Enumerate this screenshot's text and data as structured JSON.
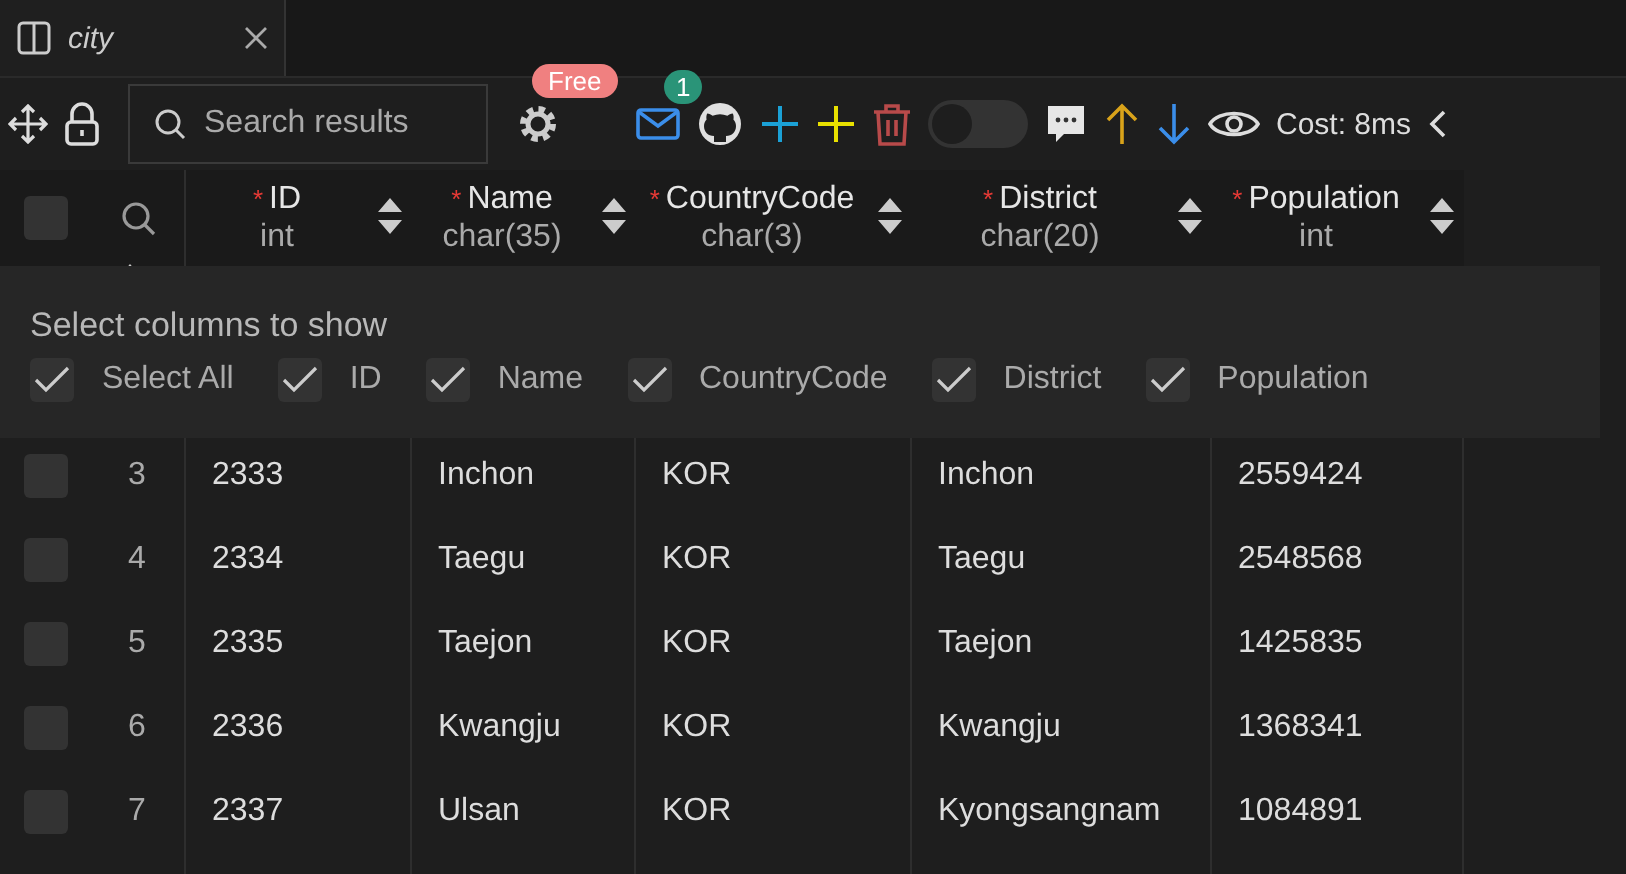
{
  "tab": {
    "title": "city"
  },
  "toolbar": {
    "search": {
      "placeholder": "Search results"
    },
    "free_badge": "Free",
    "mail_badge": "1",
    "toggle": {
      "on": false
    },
    "cost": "Cost: 8ms"
  },
  "table": {
    "header_checkbox": {
      "checked": false
    },
    "columns": [
      {
        "marker": "*",
        "name": "ID",
        "type": "int"
      },
      {
        "marker": "*",
        "name": "Name",
        "type": "char(35)"
      },
      {
        "marker": "*",
        "name": "CountryCode",
        "type": "char(3)"
      },
      {
        "marker": "*",
        "name": "District",
        "type": "char(20)"
      },
      {
        "marker": "*",
        "name": "Population",
        "type": "int"
      }
    ],
    "rows": [
      {
        "index": "3",
        "cells": [
          "2333",
          "Inchon",
          "KOR",
          "Inchon",
          "2559424"
        ],
        "checked": false
      },
      {
        "index": "4",
        "cells": [
          "2334",
          "Taegu",
          "KOR",
          "Taegu",
          "2548568"
        ],
        "checked": false
      },
      {
        "index": "5",
        "cells": [
          "2335",
          "Taejon",
          "KOR",
          "Taejon",
          "1425835"
        ],
        "checked": false
      },
      {
        "index": "6",
        "cells": [
          "2336",
          "Kwangju",
          "KOR",
          "Kwangju",
          "1368341"
        ],
        "checked": false
      },
      {
        "index": "7",
        "cells": [
          "2337",
          "Ulsan",
          "KOR",
          "Kyongsangnam",
          "1084891"
        ],
        "checked": false
      }
    ]
  },
  "column_picker": {
    "title": "Select columns to show",
    "options": [
      {
        "label": "Select All",
        "checked": true
      },
      {
        "label": "ID",
        "checked": true
      },
      {
        "label": "Name",
        "checked": true
      },
      {
        "label": "CountryCode",
        "checked": true
      },
      {
        "label": "District",
        "checked": true
      },
      {
        "label": "Population",
        "checked": true
      }
    ]
  }
}
